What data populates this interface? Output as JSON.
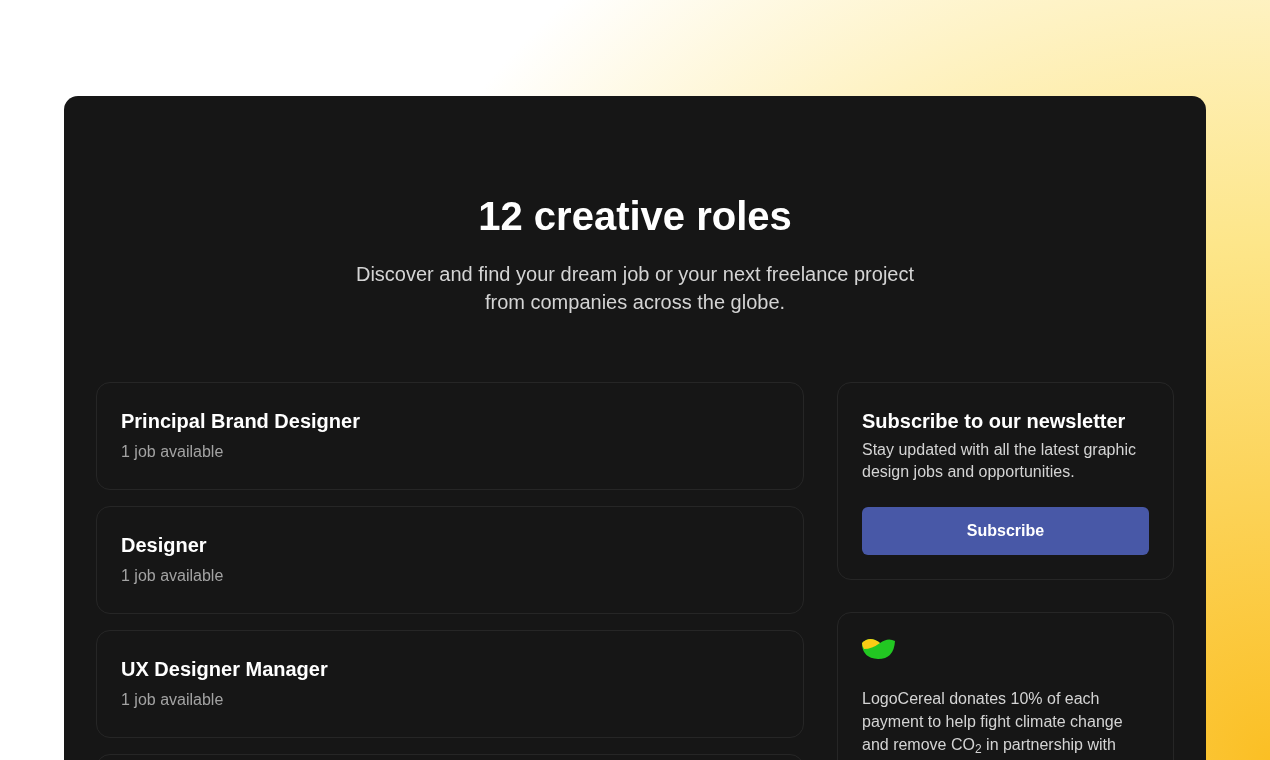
{
  "heading": "12 creative roles",
  "subtitle": "Discover and find your dream job or your next freelance project from companies across the globe.",
  "roles": [
    {
      "kind": "role",
      "title": "Principal Brand Designer",
      "count": "1 job available"
    },
    {
      "kind": "role",
      "title": "Designer",
      "count": "1 job available"
    },
    {
      "kind": "role",
      "title": "UX Designer Manager",
      "count": "1 job available"
    },
    {
      "kind": "empty"
    }
  ],
  "newsletter": {
    "title": "Subscribe to our newsletter",
    "text": "Stay updated with all the latest graphic design jobs and opportunities.",
    "button": "Subscribe"
  },
  "donation": {
    "text": "LogoCereal donates 10% of each payment to help fight climate change and remove CO$_{2}$ in partnership with"
  }
}
